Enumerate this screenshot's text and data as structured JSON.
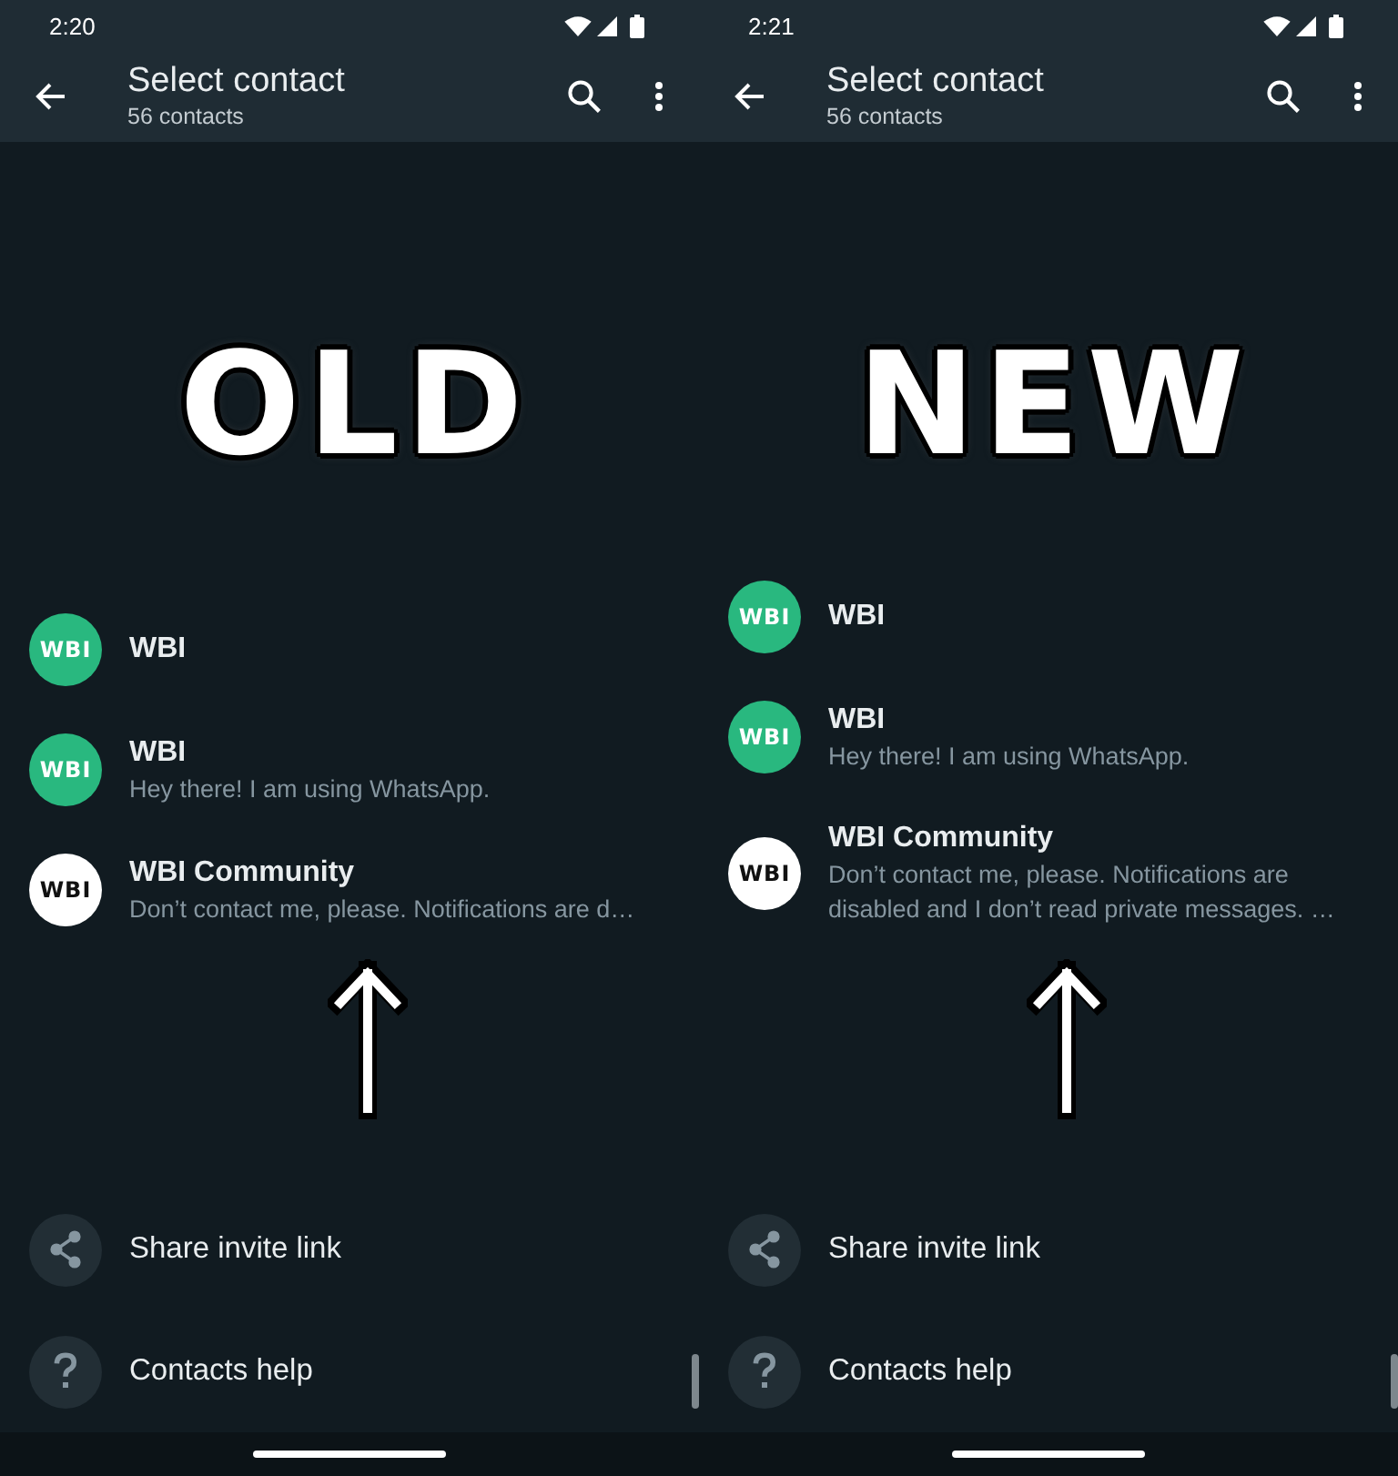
{
  "panels": [
    {
      "status_bar": {
        "time": "2:20"
      },
      "app_bar": {
        "title": "Select contact",
        "subtitle": "56 contacts"
      },
      "label": "OLD",
      "contacts": [
        {
          "kind": "contact",
          "avatar_text": "WBI",
          "name": "WBI"
        },
        {
          "kind": "contact",
          "avatar_text": "WBI",
          "name": "WBI",
          "status": "Hey there! I am using WhatsApp."
        },
        {
          "kind": "community",
          "avatar_text": "WBI",
          "name": "WBI Community",
          "status": "Don’t contact me, please. Notifications are d…"
        }
      ],
      "actions": [
        {
          "kind": "share",
          "label": "Share invite link"
        },
        {
          "kind": "help",
          "label": "Contacts help"
        }
      ]
    },
    {
      "status_bar": {
        "time": "2:21"
      },
      "app_bar": {
        "title": "Select contact",
        "subtitle": "56 contacts"
      },
      "label": "NEW",
      "contacts": [
        {
          "kind": "contact",
          "avatar_text": "WBI",
          "name": "WBI"
        },
        {
          "kind": "contact",
          "avatar_text": "WBI",
          "name": "WBI",
          "status": "Hey there! I am using WhatsApp."
        },
        {
          "kind": "community",
          "avatar_text": "WBI",
          "name": "WBI Community",
          "status": "Don’t contact me, please. Notifications are disabled and I don’t read private messages. …"
        }
      ],
      "actions": [
        {
          "kind": "share",
          "label": "Share invite link"
        },
        {
          "kind": "help",
          "label": "Contacts help"
        }
      ]
    }
  ]
}
